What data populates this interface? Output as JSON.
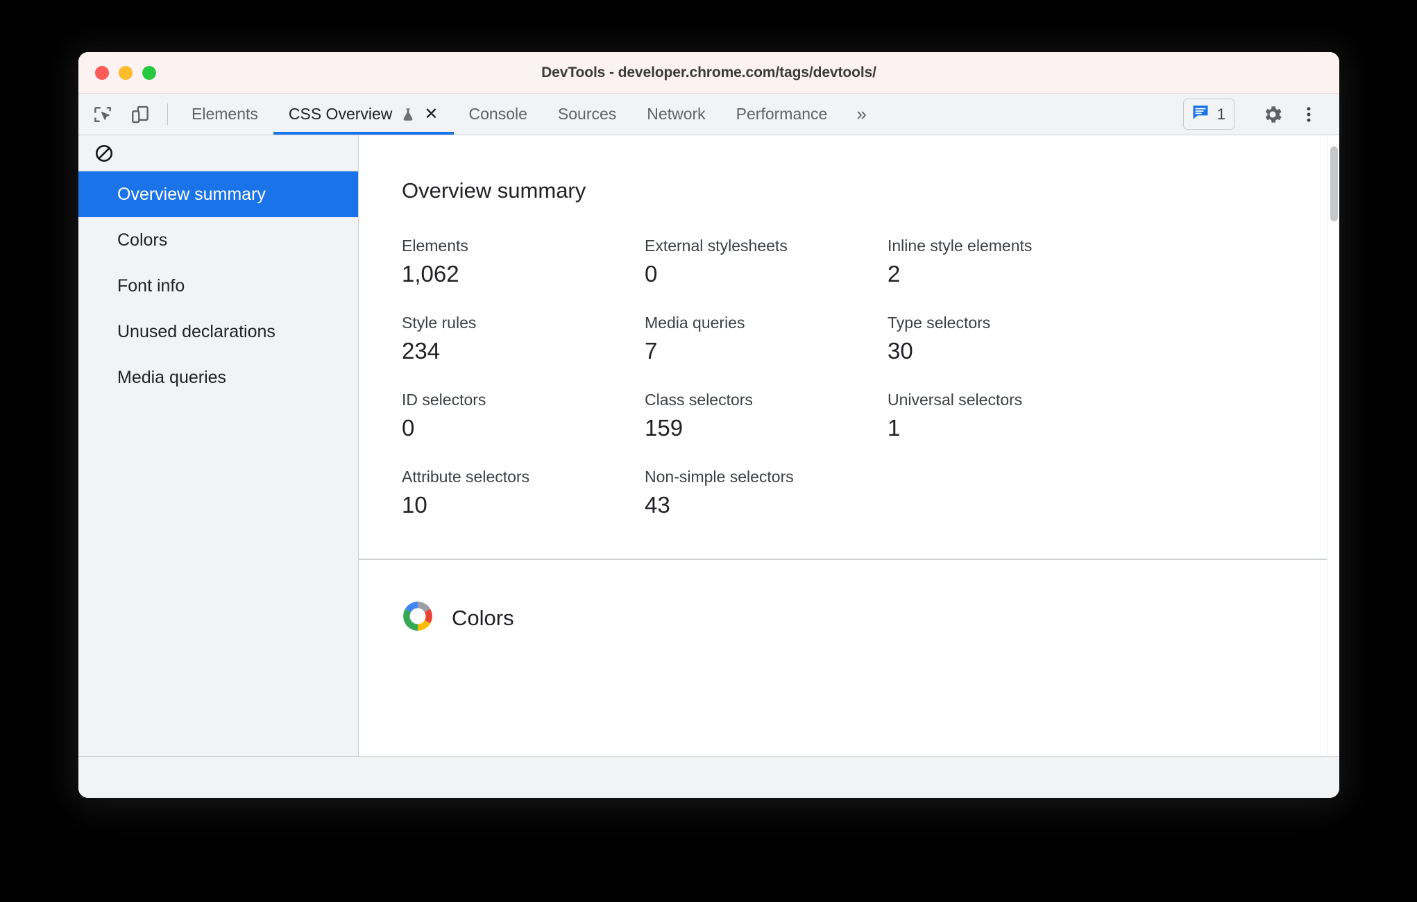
{
  "window": {
    "title": "DevTools - developer.chrome.com/tags/devtools/",
    "controls": {
      "close": "close-window",
      "minimize": "minimize-window",
      "maximize": "maximize-window"
    }
  },
  "toolbar": {
    "inspect_icon": "inspect-element-icon",
    "device_icon": "device-toolbar-icon",
    "overflow_label": "»",
    "messages_count": "1",
    "messages_icon": "message-icon",
    "settings_icon": "gear-icon",
    "more_icon": "more-vertical-icon"
  },
  "tabs": [
    {
      "label": "Elements",
      "active": false
    },
    {
      "label": "CSS Overview",
      "active": true,
      "experimental": true,
      "closable": true
    },
    {
      "label": "Console",
      "active": false
    },
    {
      "label": "Sources",
      "active": false
    },
    {
      "label": "Network",
      "active": false
    },
    {
      "label": "Performance",
      "active": false
    }
  ],
  "sidebar": {
    "clear_icon": "no-entry-icon",
    "items": [
      {
        "label": "Overview summary",
        "selected": true
      },
      {
        "label": "Colors",
        "selected": false
      },
      {
        "label": "Font info",
        "selected": false
      },
      {
        "label": "Unused declarations",
        "selected": false
      },
      {
        "label": "Media queries",
        "selected": false
      }
    ]
  },
  "main": {
    "summary_title": "Overview summary",
    "metrics": [
      {
        "label": "Elements",
        "value": "1,062"
      },
      {
        "label": "External stylesheets",
        "value": "0"
      },
      {
        "label": "Inline style elements",
        "value": "2"
      },
      {
        "label": "Style rules",
        "value": "234"
      },
      {
        "label": "Media queries",
        "value": "7"
      },
      {
        "label": "Type selectors",
        "value": "30"
      },
      {
        "label": "ID selectors",
        "value": "0"
      },
      {
        "label": "Class selectors",
        "value": "159"
      },
      {
        "label": "Universal selectors",
        "value": "1"
      },
      {
        "label": "Attribute selectors",
        "value": "10"
      },
      {
        "label": "Non-simple selectors",
        "value": "43"
      }
    ],
    "colors_section": {
      "title": "Colors",
      "icon": "color-wheel-icon"
    }
  },
  "colors": {
    "accent_blue": "#1a73e8",
    "titlebar_bg": "#fbf2f1",
    "toolbar_bg": "#f1f3f4",
    "text_primary": "#202124",
    "text_secondary": "#5f6368",
    "traffic_red": "#fc5b57",
    "traffic_yellow": "#fdbc2c",
    "traffic_green": "#28c840",
    "wheel_red": "#ea4335",
    "wheel_yellow": "#fbbc04",
    "wheel_green": "#34a853",
    "wheel_blue": "#4285f4",
    "wheel_gray": "#9aa0a6"
  }
}
